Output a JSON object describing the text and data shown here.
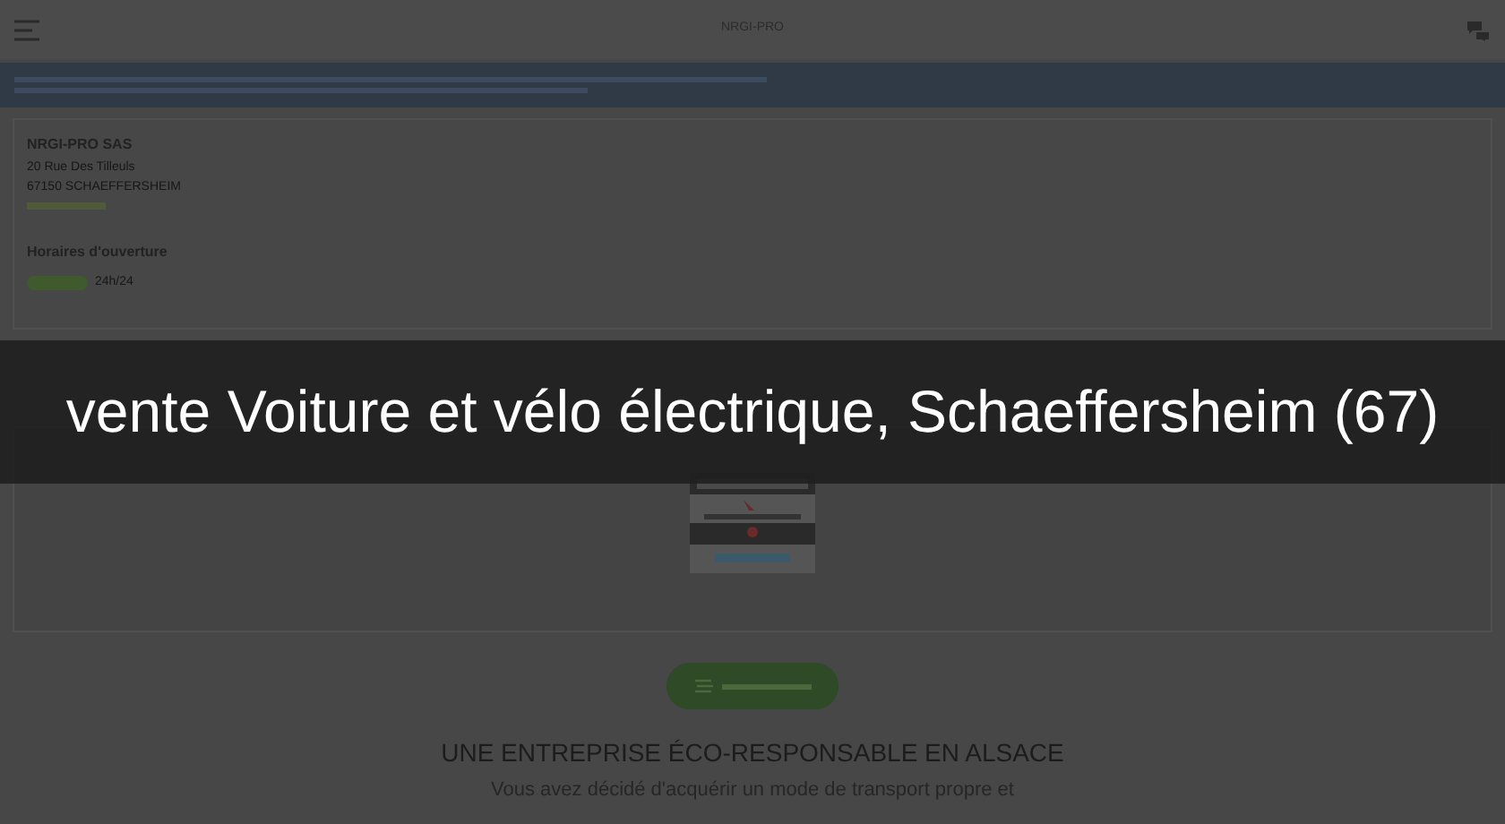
{
  "header": {
    "title": "NRGI-PRO"
  },
  "company": {
    "name": "NRGI-PRO SAS",
    "street": "20 Rue Des Tilleuls",
    "city": "67150 SCHAEFFERSHEIM"
  },
  "hours": {
    "title": "Horaires d'ouverture",
    "schedule": "24h/24"
  },
  "caption": "vente Voiture et vélo électrique, Schaeffersheim (67)",
  "section": {
    "title": "UNE ENTREPRISE ÉCO-RESPONSABLE EN ALSACE",
    "text": "Vous avez décidé d'acquérir un mode de transport propre et"
  }
}
